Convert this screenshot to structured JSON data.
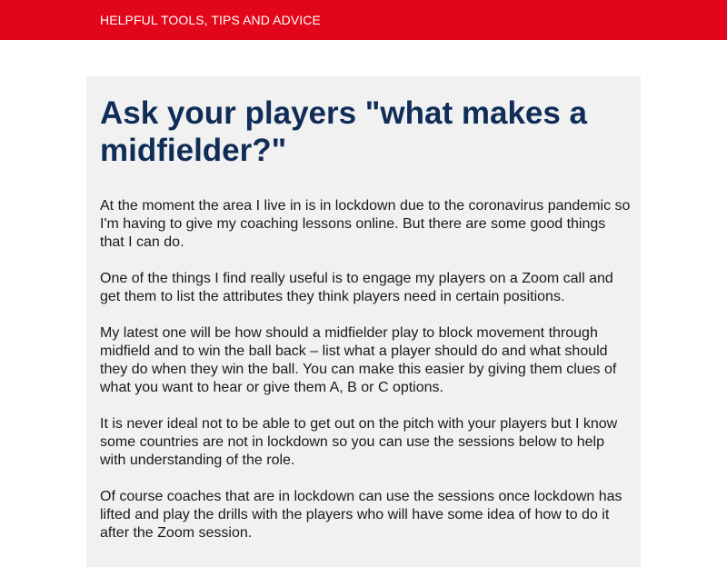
{
  "header": {
    "label": "HELPFUL TOOLS, TIPS AND ADVICE"
  },
  "article": {
    "title": "Ask your players \"what makes a midfielder?\"",
    "paragraphs": [
      "At the moment the area I live in is in lockdown due to the coronavirus pandemic so I'm having to give my coaching lessons online. But there are some good things that I can do.",
      "One of the things I find really useful is to engage my players on a Zoom call and get them to list the attributes they think players need in certain positions.",
      "My latest one will be how should a midfielder play to block movement through midfield and to win the ball back – list what a  player should do and what should they do when they win the ball. You can make this easier by giving them clues of what you want to hear or give them A, B or C options.",
      "It is never ideal not to be able to get out on the pitch with your players but I know some countries are not in lockdown so you can use the sessions below to help with understanding of the role.",
      "Of course coaches that are in lockdown can use the sessions once lockdown has lifted and play the drills with the players who will have some idea of how to do it after the Zoom session."
    ]
  },
  "colors": {
    "header_bg": "#e2061a",
    "title": "#0f2d57",
    "card_bg": "#f2f1f2"
  }
}
